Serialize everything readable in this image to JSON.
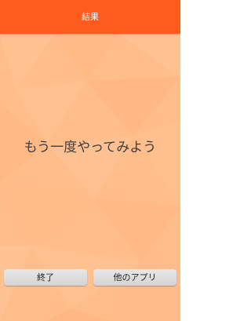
{
  "header": {
    "title": "結果"
  },
  "main": {
    "message": "もう一度やってみよう"
  },
  "buttons": {
    "exit_label": "終了",
    "other_apps_label": "他のアプリ"
  }
}
